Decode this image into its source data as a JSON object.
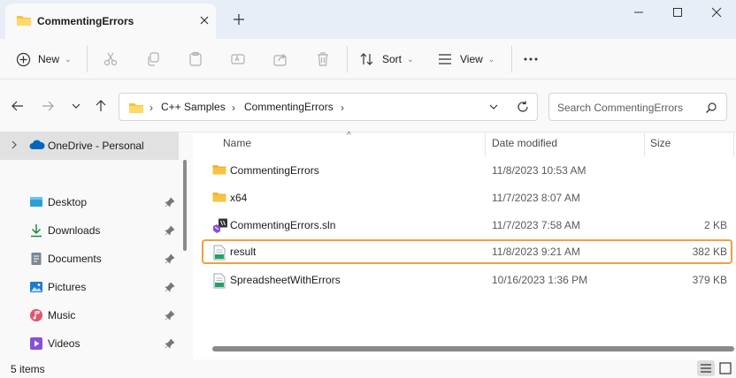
{
  "window": {
    "tab_title": "CommentingErrors",
    "icons": [
      "folder-icon",
      "close-icon",
      "plus-icon",
      "minimize-icon",
      "maximize-icon",
      "close-window-icon"
    ]
  },
  "toolbar": {
    "new_label": "New",
    "sort_label": "Sort",
    "view_label": "View",
    "icons": [
      "plus-circle-icon",
      "cut-icon",
      "copy-icon",
      "paste-icon",
      "rename-icon",
      "share-icon",
      "delete-icon",
      "sort-icon",
      "view-icon",
      "more-icon"
    ]
  },
  "address": {
    "breadcrumb": [
      "C++ Samples",
      "CommentingErrors"
    ],
    "search_placeholder": "Search CommentingErrors"
  },
  "sidebar": {
    "onedrive": "OneDrive - Personal",
    "items": [
      {
        "label": "Desktop",
        "icon": "desktop-icon"
      },
      {
        "label": "Downloads",
        "icon": "download-icon"
      },
      {
        "label": "Documents",
        "icon": "documents-icon"
      },
      {
        "label": "Pictures",
        "icon": "pictures-icon"
      },
      {
        "label": "Music",
        "icon": "music-icon"
      },
      {
        "label": "Videos",
        "icon": "videos-icon"
      }
    ]
  },
  "columns": {
    "name": "Name",
    "date": "Date modified",
    "size": "Size"
  },
  "files": [
    {
      "name": "CommentingErrors",
      "date": "11/8/2023 10:53 AM",
      "size": "",
      "icon": "folder-icon"
    },
    {
      "name": "x64",
      "date": "11/7/2023 8:07 AM",
      "size": "",
      "icon": "folder-icon"
    },
    {
      "name": "CommentingErrors.sln",
      "date": "11/7/2023 7:58 AM",
      "size": "2 KB",
      "icon": "solution-file-icon"
    },
    {
      "name": "result",
      "date": "11/8/2023 9:21 AM",
      "size": "382 KB",
      "icon": "csv-file-icon"
    },
    {
      "name": "SpreadsheetWithErrors",
      "date": "10/16/2023 1:36 PM",
      "size": "379 KB",
      "icon": "csv-file-icon"
    }
  ],
  "status": {
    "item_count": "5 items"
  },
  "colors": {
    "highlight": "#f0a040",
    "folder": "#f6c344",
    "accent": "#0067c0"
  }
}
